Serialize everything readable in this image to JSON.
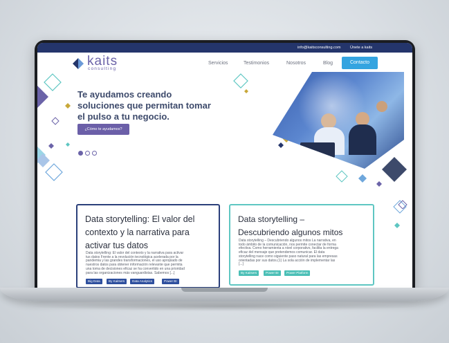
{
  "topbar": {
    "email": "info@kaitsconsulting.com",
    "join": "Únete a kaits"
  },
  "brand": {
    "name": "kaits",
    "sub": "consulting",
    "colors": {
      "primary": "#6b63a8",
      "accent": "#34a4e0",
      "teal": "#5ec6c2",
      "navy": "#24356b"
    }
  },
  "nav": {
    "items": [
      "Servicios",
      "Testimonios",
      "Nosotros",
      "Blog"
    ],
    "contact": "Contacto"
  },
  "hero": {
    "line1": "Te ayudamos creando",
    "line2": "soluciones que permitan tomar",
    "line3": "el pulso a tu negocio.",
    "button": "¿Cómo te ayudamos?",
    "slides_total": 3,
    "slide_active": 1
  },
  "cards": [
    {
      "title_lines": [
        "Data storytelling: El valor del",
        "contexto y la narrativa para",
        "activar tus datos"
      ],
      "body_lines": [
        "Data storytelling: El valor del contexto y la narrativa para activar",
        "tus datos Frente a la revolución tecnológica acelerada por la",
        "pandemia y las grandes transformaciones, el uso apropiado de",
        "nuestros datos para obtener información relevante que permita",
        "una toma de decisiones eficaz se ha convertido en una prioridad",
        "para las organizaciones más vanguardistas. Sabemos [...]"
      ],
      "tags": [
        "Big Data",
        "By Kaitsers",
        "Data Analytics",
        "Power BI"
      ]
    },
    {
      "title_lines": [
        "Data storytelling –",
        "Descubriendo algunos mitos"
      ],
      "body_lines": [
        "Data storytelling – Descubriendo algunos mitos La narrativa, en",
        "todo ámbito de la comunicación, nos permite conectar de forma",
        "efectiva. Como herramienta a nivel corporativo, facilita la entrega",
        "eficaz del mensaje que pretendemos comunicar. El data",
        "storytelling nace como siguiente paso natural para las empresas",
        "orientadas por sus datos.(1) La sola acción de implementar las",
        "[...]"
      ],
      "tags": [
        "By Kaitsers",
        "Power BI",
        "Power Platform"
      ]
    }
  ]
}
